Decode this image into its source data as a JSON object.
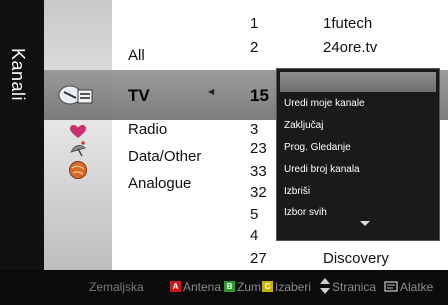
{
  "title": "Kanali",
  "icons": [
    "satellite-tv-icon",
    "heart-icon",
    "satellite-dish-icon",
    "globe-icon"
  ],
  "categories": [
    "All",
    "TV",
    "Radio",
    "Data/Other",
    "Analogue"
  ],
  "channels": [
    {
      "num": "1",
      "name": "1futech"
    },
    {
      "num": "2",
      "name": "24ore.tv"
    },
    {
      "num": "15",
      "name": ""
    },
    {
      "num": "3",
      "name": ""
    },
    {
      "num": "23",
      "name": ""
    },
    {
      "num": "33",
      "name": ""
    },
    {
      "num": "32",
      "name": ""
    },
    {
      "num": "5",
      "name": ""
    },
    {
      "num": "4",
      "name": ""
    },
    {
      "num": "27",
      "name": "Discovery"
    }
  ],
  "popup_menu": [
    "Uredi moje kanale",
    "Zaključaj",
    "Prog. Gledanje",
    "Uredi broj kanala",
    "Izbriši",
    "Izbor svih"
  ],
  "bottom_bar": {
    "mode": "Zemaljska",
    "keys": [
      {
        "key": "A",
        "label": "Antena"
      },
      {
        "key": "B",
        "label": "Zum"
      },
      {
        "key": "C",
        "label": "Izaberi"
      }
    ],
    "page_label": "Stranica",
    "tools_label": "Alatke"
  },
  "colors": {
    "key_a": "#c61c1c",
    "key_b": "#2e9a2e",
    "key_c": "#c8b400",
    "key_d": "#1f4fb8"
  }
}
